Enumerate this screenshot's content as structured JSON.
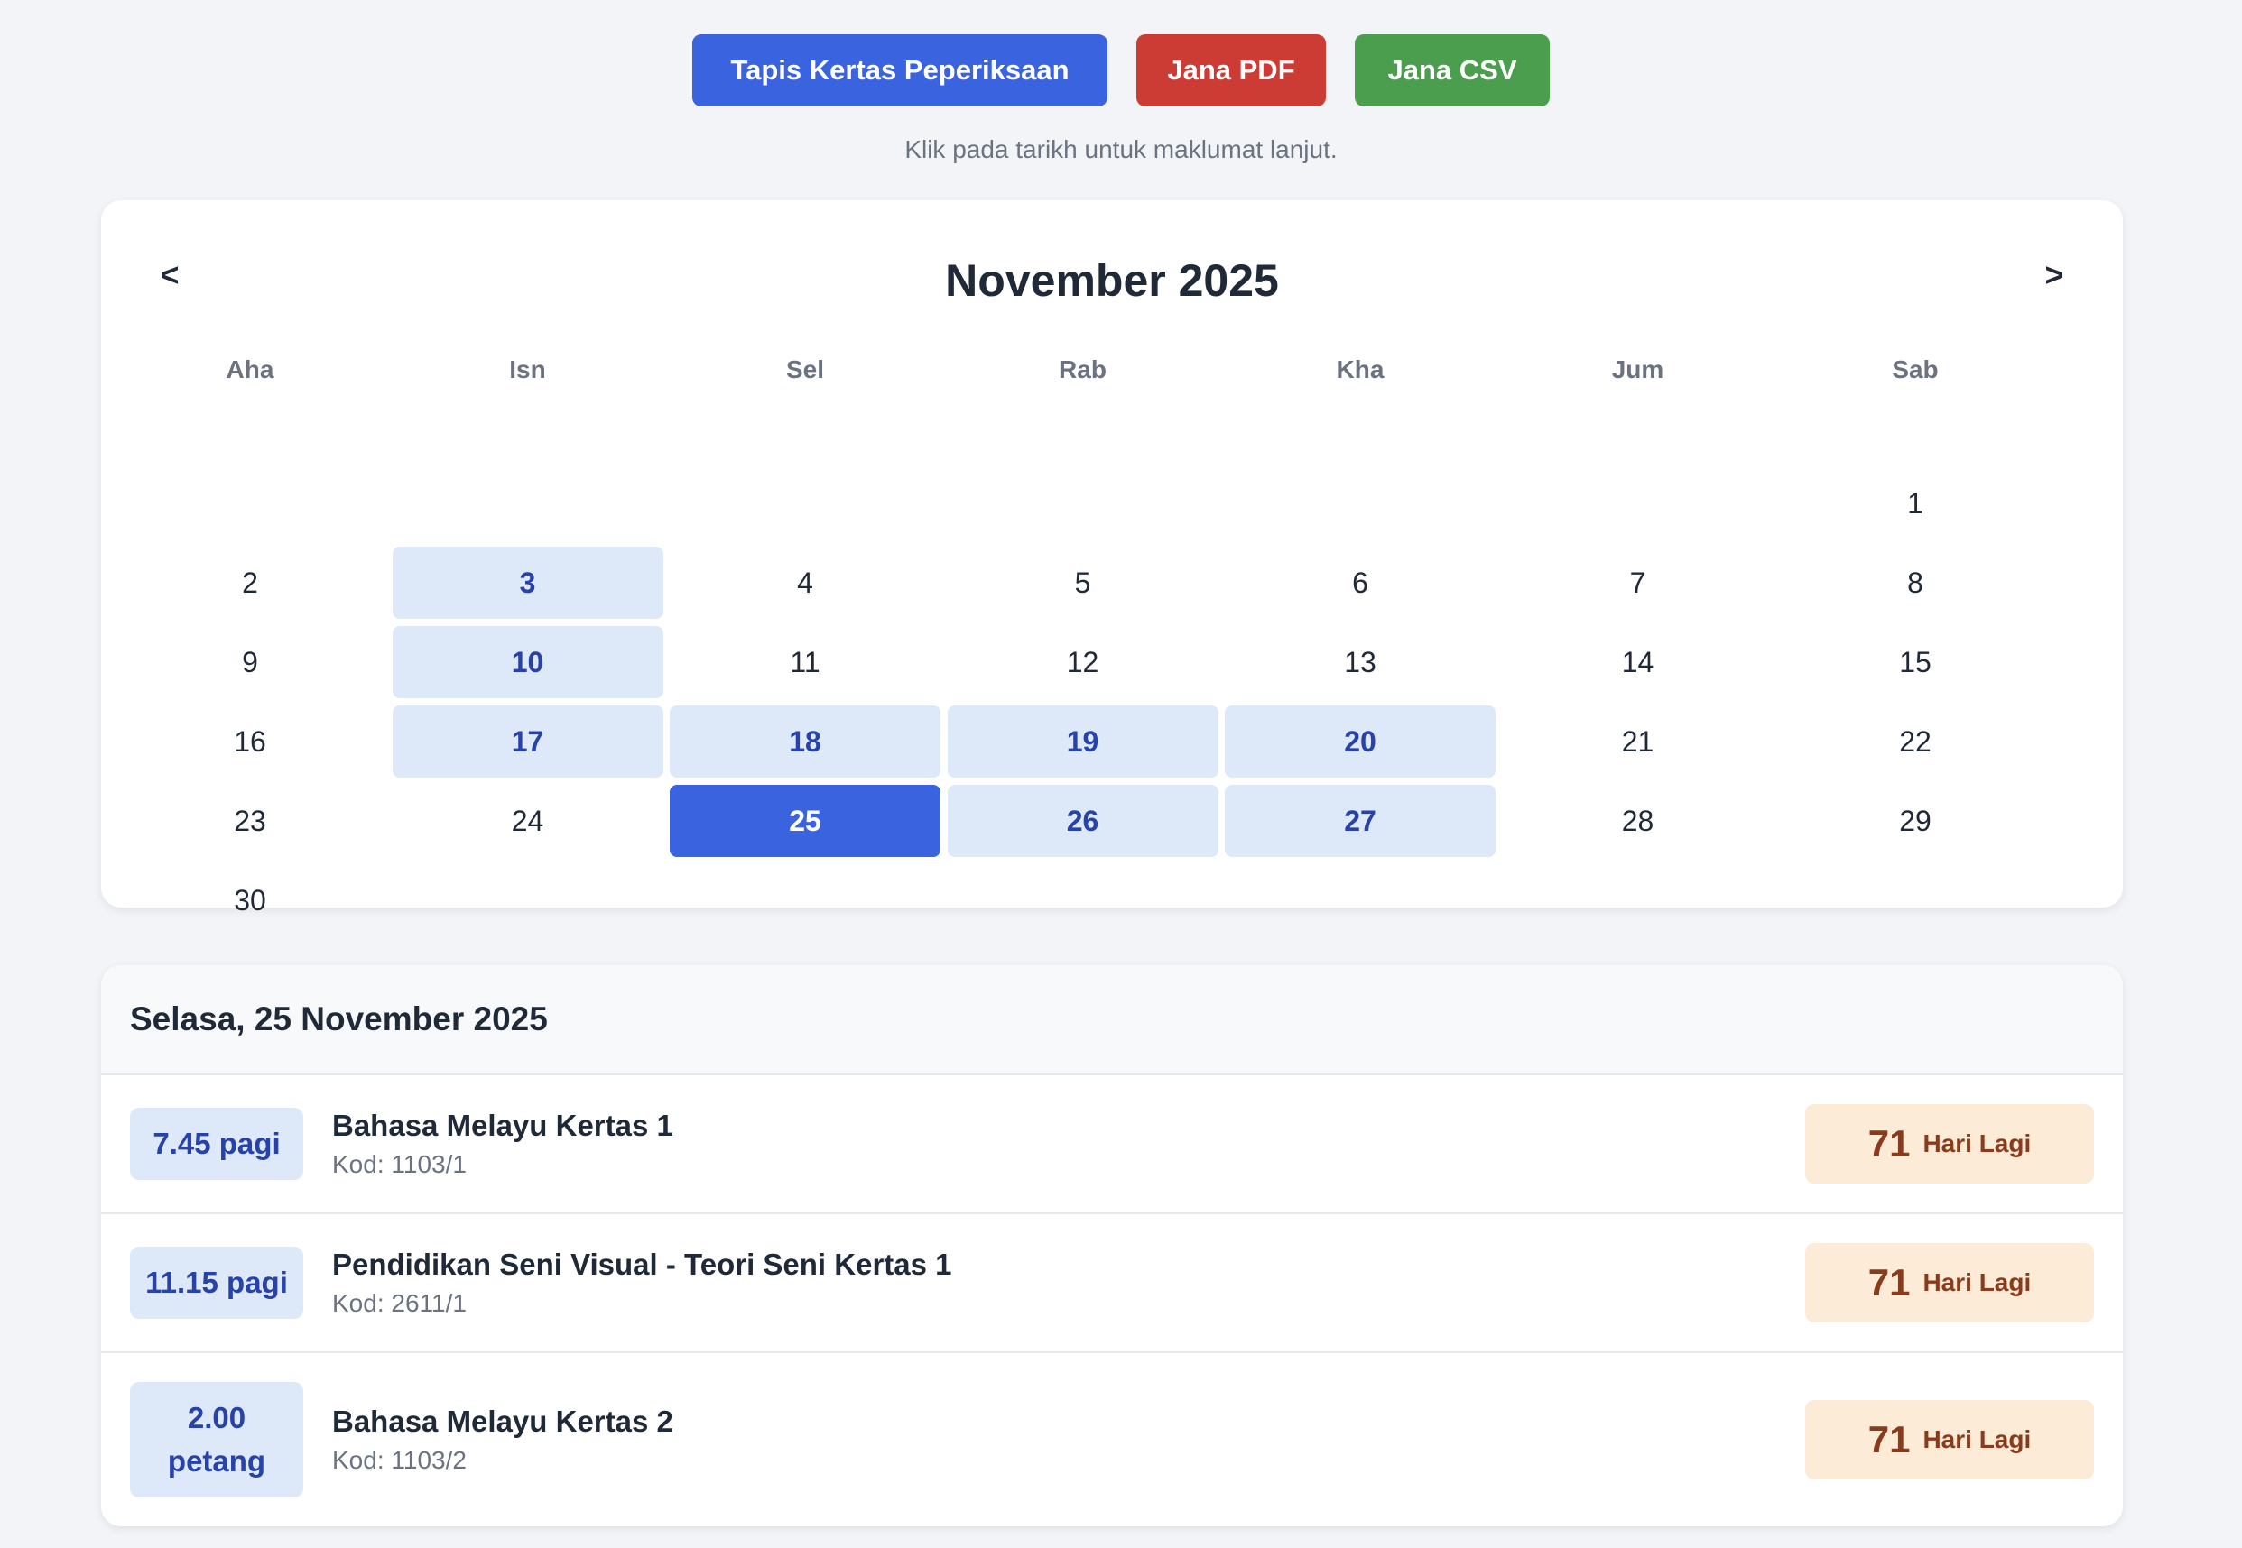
{
  "toolbar": {
    "filter_label": "Tapis Kertas Peperiksaan",
    "pdf_label": "Jana PDF",
    "csv_label": "Jana CSV"
  },
  "hint": "Klik pada tarikh untuk maklumat lanjut.",
  "calendar": {
    "title": "November 2025",
    "prev_label": "<",
    "next_label": ">",
    "weekdays": [
      "Aha",
      "Isn",
      "Sel",
      "Rab",
      "Kha",
      "Jum",
      "Sab"
    ],
    "first_weekday_index": 6,
    "days_in_month": 30,
    "exam_days": [
      3,
      10,
      17,
      18,
      19,
      20,
      25,
      26,
      27
    ],
    "selected_day": 25
  },
  "details": {
    "header": "Selasa, 25 November 2025",
    "exams": [
      {
        "time": "7.45 pagi",
        "name": "Bahasa Melayu Kertas 1",
        "code": "Kod: 1103/1",
        "days": "71",
        "days_label": "Hari Lagi"
      },
      {
        "time": "11.15 pagi",
        "name": "Pendidikan Seni Visual - Teori Seni Kertas 1",
        "code": "Kod: 2611/1",
        "days": "71",
        "days_label": "Hari Lagi"
      },
      {
        "time": "2.00 petang",
        "name": "Bahasa Melayu Kertas 2",
        "code": "Kod: 1103/2",
        "days": "71",
        "days_label": "Hari Lagi"
      }
    ]
  },
  "colors": {
    "primary": "#3a63e0",
    "danger": "#cc3b34",
    "success": "#4a9e4d",
    "exam_day_bg": "#dde8f8",
    "countdown_bg": "#fcebd7"
  }
}
